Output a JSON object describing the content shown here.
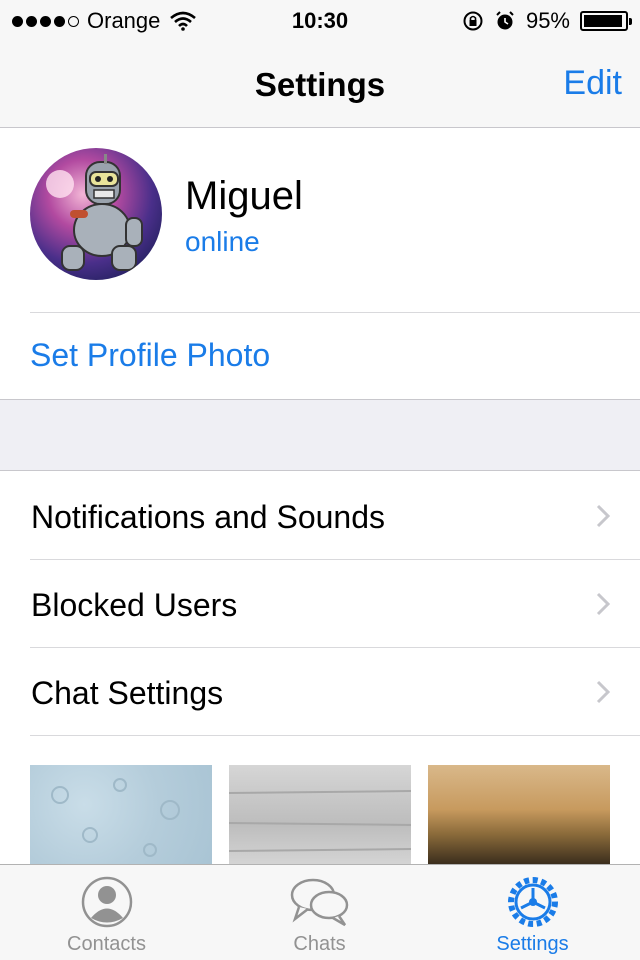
{
  "status_bar": {
    "carrier": "Orange",
    "time": "10:30",
    "battery_percent_text": "95%",
    "battery_level": 0.95,
    "icons": [
      "signal-dots-icon",
      "wifi-icon",
      "rotation-lock-icon",
      "alarm-icon",
      "battery-icon"
    ]
  },
  "nav": {
    "title": "Settings",
    "edit_label": "Edit"
  },
  "profile": {
    "name": "Miguel",
    "status": "online",
    "set_photo_label": "Set Profile Photo"
  },
  "menu": {
    "items": [
      {
        "label": "Notifications and Sounds"
      },
      {
        "label": "Blocked Users"
      },
      {
        "label": "Chat Settings"
      }
    ]
  },
  "wallpapers": [
    "wallpaper-blue-pattern",
    "wallpaper-gray-wood",
    "wallpaper-blurred-landscape"
  ],
  "tabs": {
    "contacts": "Contacts",
    "chats": "Chats",
    "settings": "Settings",
    "active": "settings"
  },
  "colors": {
    "accent": "#1a7ce8",
    "tab_inactive": "#929292",
    "group_background": "#efeff4"
  }
}
